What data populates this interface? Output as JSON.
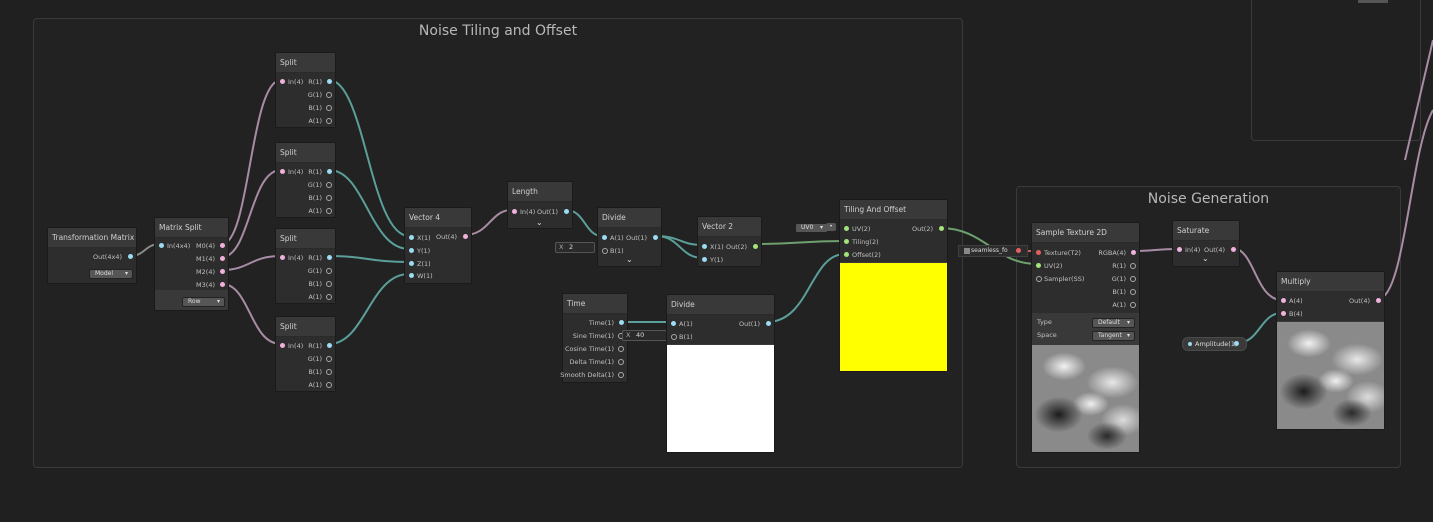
{
  "groups": {
    "tiling": "Noise Tiling and Offset",
    "generation": "Noise Generation"
  },
  "transform_matrix": {
    "title": "Transformation Matrix",
    "out": "Out(4x4)",
    "space": "Model"
  },
  "matrix_split": {
    "title": "Matrix Split",
    "in": "In(4x4)",
    "outs": [
      "M0(4)",
      "M1(4)",
      "M2(4)",
      "M3(4)"
    ],
    "mode": "Row"
  },
  "split": {
    "title": "Split",
    "in": "In(4)",
    "outs": [
      "R(1)",
      "G(1)",
      "B(1)",
      "A(1)"
    ]
  },
  "vector4": {
    "title": "Vector 4",
    "ins": [
      "X(1)",
      "Y(1)",
      "Z(1)",
      "W(1)"
    ],
    "out": "Out(4)"
  },
  "length": {
    "title": "Length",
    "in": "In(4)",
    "out": "Out(1)"
  },
  "divide1": {
    "title": "Divide",
    "a": "A(1)",
    "b": "B(1)",
    "out": "Out(1)",
    "b_prefix": "X",
    "b_value": "2"
  },
  "vector2": {
    "title": "Vector 2",
    "ins": [
      "X(1)",
      "Y(1)"
    ],
    "out": "Out(2)"
  },
  "tiling_offset": {
    "title": "Tiling And Offset",
    "ins": [
      "UV(2)",
      "Tiling(2)",
      "Offset(2)"
    ],
    "out": "Out(2)",
    "uv_value": "UV0",
    "preview_color": "#ffff00"
  },
  "time": {
    "title": "Time",
    "outs": [
      "Time(1)",
      "Sine Time(1)",
      "Cosine Time(1)",
      "Delta Time(1)",
      "Smooth Delta(1)"
    ]
  },
  "divide2": {
    "title": "Divide",
    "a": "A(1)",
    "b": "B(1)",
    "out": "Out(1)",
    "b_prefix": "X",
    "b_value": "40",
    "preview_color": "#ffffff"
  },
  "texture_prop": {
    "label": "seamless_fo"
  },
  "sample_texture": {
    "title": "Sample Texture 2D",
    "ins": [
      "Texture(T2)",
      "UV(2)",
      "Sampler(SS)"
    ],
    "outs": [
      "RGBA(4)",
      "R(1)",
      "G(1)",
      "B(1)",
      "A(1)"
    ],
    "type_label": "Type",
    "type_value": "Default",
    "space_label": "Space",
    "space_value": "Tangent"
  },
  "saturate": {
    "title": "Saturate",
    "in": "In(4)",
    "out": "Out(4)"
  },
  "multiply": {
    "title": "Multiply",
    "ins": [
      "A(4)",
      "B(4)"
    ],
    "out": "Out(4)"
  },
  "amplitude": {
    "label": "Amplitude(1)"
  },
  "colors": {
    "background": "#202020",
    "node": "#393939",
    "wire_float": "#5a9f9a",
    "wire_vec4": "#a88ca5",
    "wire_vec2": "#6ea06e",
    "port_float": "#9bdcf2",
    "port_vec4": "#f0b2dc",
    "port_vec2": "#a5e37a"
  }
}
